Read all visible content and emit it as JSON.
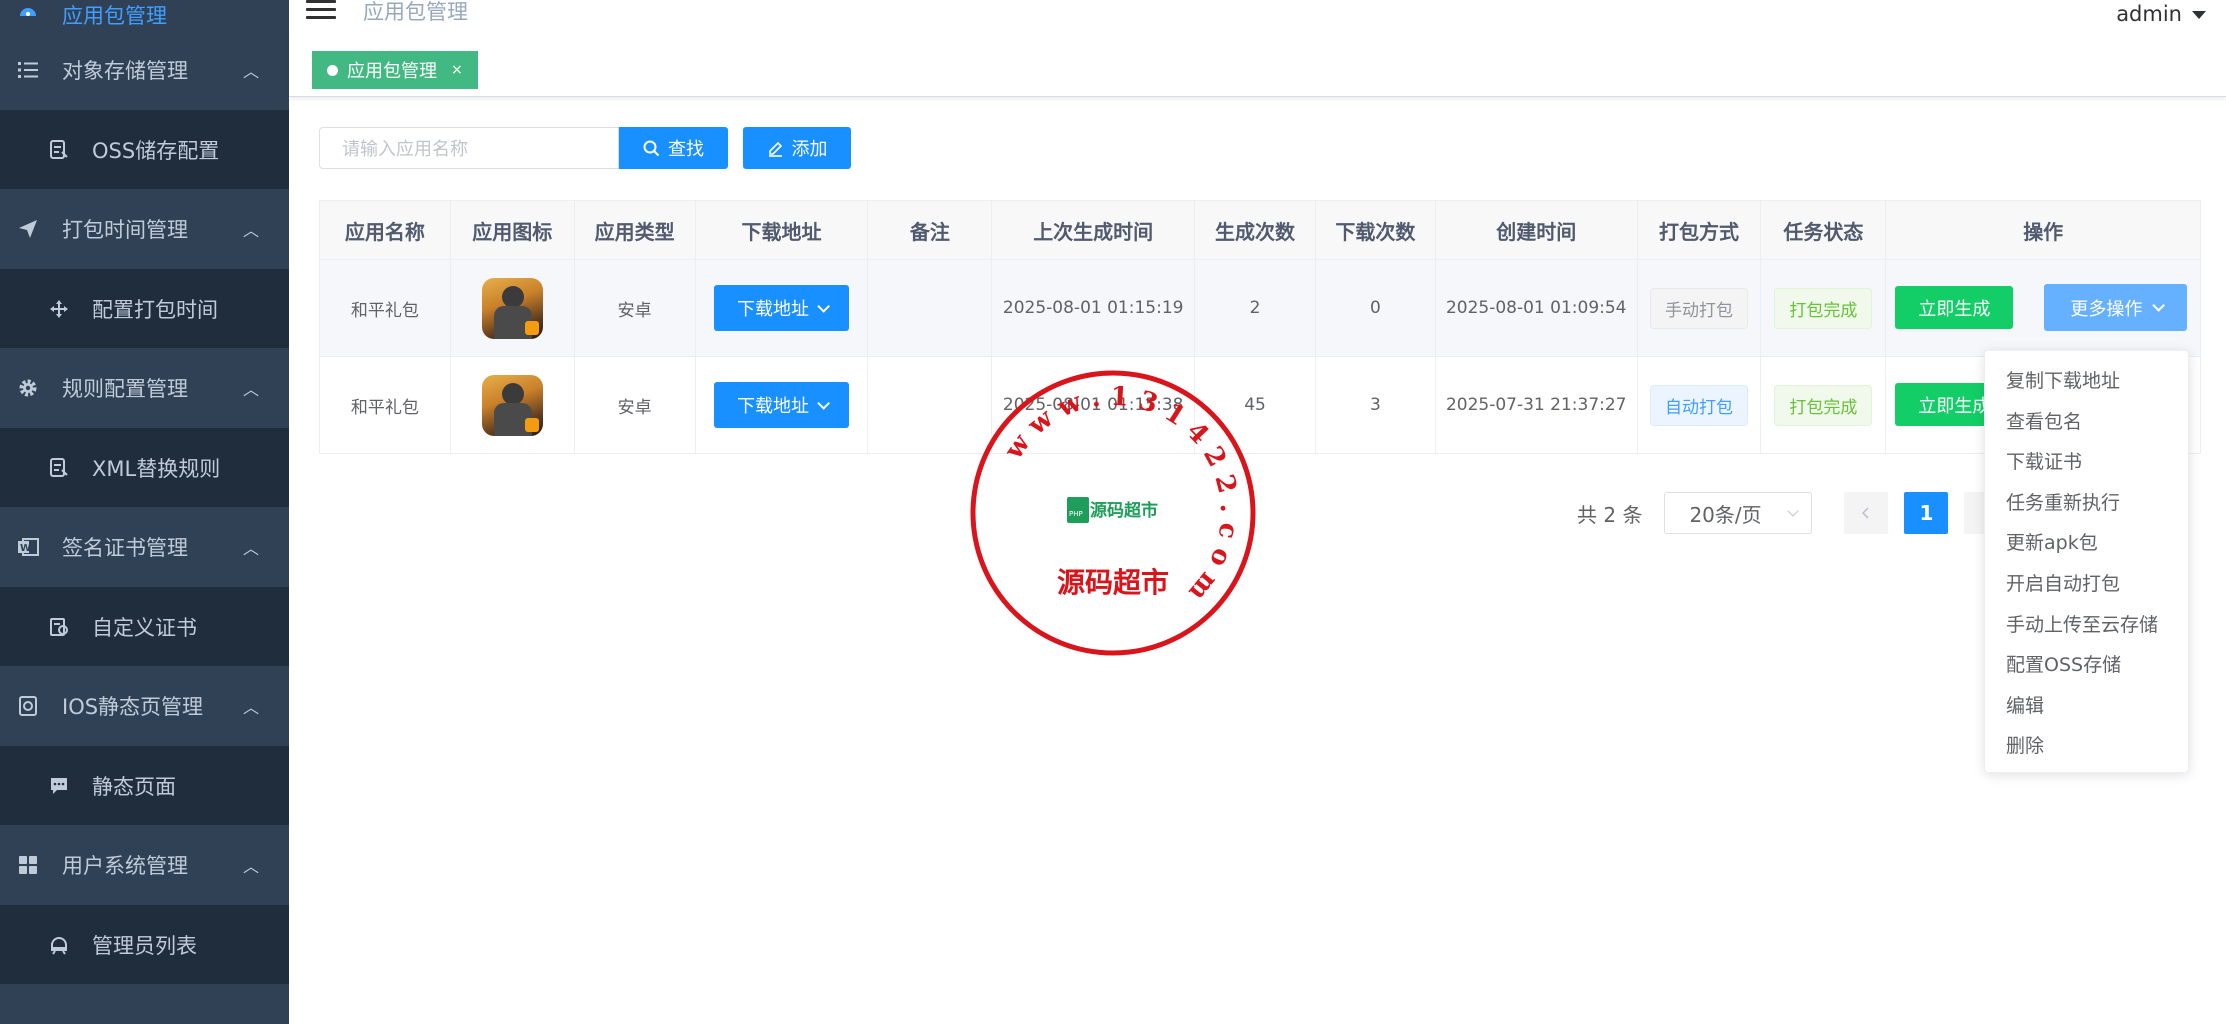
{
  "sidebar": {
    "active_item": {
      "label": "应用包管理",
      "icon": "dashboard-icon"
    },
    "groups": [
      {
        "label": "对象存储管理",
        "icon": "list-icon",
        "child": {
          "label": "OSS储存配置",
          "icon": "document-edit-icon"
        }
      },
      {
        "label": "打包时间管理",
        "icon": "send-icon",
        "child": {
          "label": "配置打包时间",
          "icon": "move-icon"
        }
      },
      {
        "label": "规则配置管理",
        "icon": "gear-icon",
        "child": {
          "label": "XML替换规则",
          "icon": "document-edit-icon"
        }
      },
      {
        "label": "签名证书管理",
        "icon": "word-doc-icon",
        "child": {
          "label": "自定义证书",
          "icon": "certificate-icon"
        }
      },
      {
        "label": "IOS静态页管理",
        "icon": "safe-icon",
        "child": {
          "label": "静态页面",
          "icon": "message-icon"
        }
      },
      {
        "label": "用户系统管理",
        "icon": "grid-icon",
        "child": {
          "label": "管理员列表",
          "icon": "user-icon"
        }
      }
    ]
  },
  "header": {
    "breadcrumb": "应用包管理",
    "user": "admin"
  },
  "tags": {
    "active": "应用包管理",
    "close": "×"
  },
  "toolbar": {
    "search_placeholder": "请输入应用名称",
    "search_label": "查找",
    "add_label": "添加"
  },
  "table": {
    "columns": [
      "应用名称",
      "应用图标",
      "应用类型",
      "下载地址",
      "备注",
      "上次生成时间",
      "生成次数",
      "下载次数",
      "创建时间",
      "打包方式",
      "任务状态",
      "操作"
    ],
    "rows": [
      {
        "name": "和平礼包",
        "type": "安卓",
        "download_label": "下载地址",
        "remark": "",
        "last_generated": "2025-08-01 01:15:19",
        "generate_count": "2",
        "download_count": "0",
        "created": "2025-08-01 01:09:54",
        "pack_mode": "手动打包",
        "task_status": "打包完成",
        "generate_label": "立即生成",
        "more_label": "更多操作"
      },
      {
        "name": "和平礼包",
        "type": "安卓",
        "download_label": "下载地址",
        "remark": "",
        "last_generated": "2025-08-01 01:15:38",
        "generate_count": "45",
        "download_count": "3",
        "created": "2025-07-31 21:37:27",
        "pack_mode": "自动打包",
        "task_status": "打包完成",
        "generate_label": "立即生成"
      }
    ]
  },
  "pagination": {
    "total": "共 2 条",
    "page_size": "20条/页",
    "current_page": "1"
  },
  "dropdown": {
    "items": [
      "复制下载地址",
      "查看包名",
      "下载证书",
      "任务重新执行",
      "更新apk包",
      "开启自动打包",
      "手动上传至云存储",
      "配置OSS存储",
      "编辑",
      "删除"
    ]
  },
  "watermark": {
    "ring_text": "w w w . 1 3 1 4 2 2 . c o m",
    "name": "源码超市",
    "logo": "源码超市"
  },
  "colors": {
    "sidebar_bg": "#304156",
    "submenu_bg": "#1f2d3d",
    "primary": "#1890ff",
    "success": "#13ce66",
    "tag_green": "#42b983",
    "stamp_red": "#d9141b"
  }
}
